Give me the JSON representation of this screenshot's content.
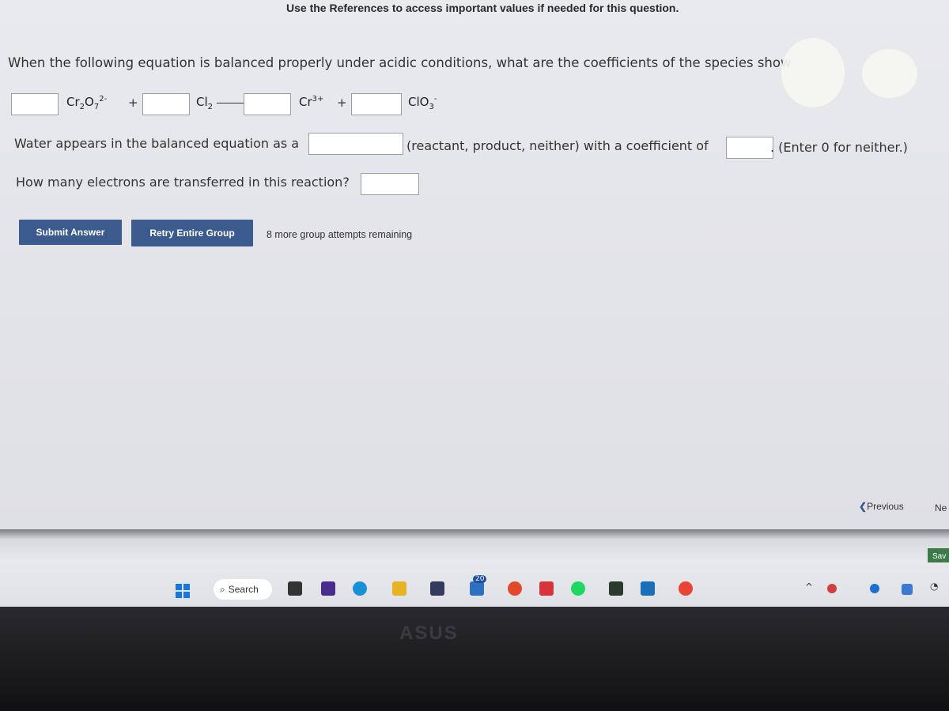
{
  "references_note": "Use the References to access important values if needed for this question.",
  "question": "When the following equation is balanced properly under acidic conditions, what are the coefficients of the species show",
  "equation": {
    "species": [
      {
        "base": "Cr",
        "sub1": "2",
        "mid": "O",
        "sub2": "7",
        "sup": "2-"
      },
      {
        "base": "Cl",
        "sub1": "2"
      },
      {
        "base": "Cr",
        "sup": "3+"
      },
      {
        "base": "ClO",
        "sub1": "3",
        "sup": "-"
      }
    ],
    "plus": "+",
    "coefficients": [
      "",
      "",
      "",
      ""
    ]
  },
  "water": {
    "prefix": "Water appears in the balanced equation as a",
    "role_value": "",
    "middle": "(reactant, product, neither) with a coefficient of",
    "coef_value": "",
    "suffix": ". (Enter 0 for neither.)"
  },
  "electrons": {
    "label": "How many electrons are transferred in this reaction?",
    "value": ""
  },
  "buttons": {
    "submit": "Submit Answer",
    "retry": "Retry Entire Group"
  },
  "attempts": "8 more group attempts remaining",
  "nav": {
    "previous": "Previous",
    "next": "Ne",
    "save": "Sav"
  },
  "taskbar": {
    "search": "Search",
    "badge": "20",
    "brand": "ASUS"
  }
}
